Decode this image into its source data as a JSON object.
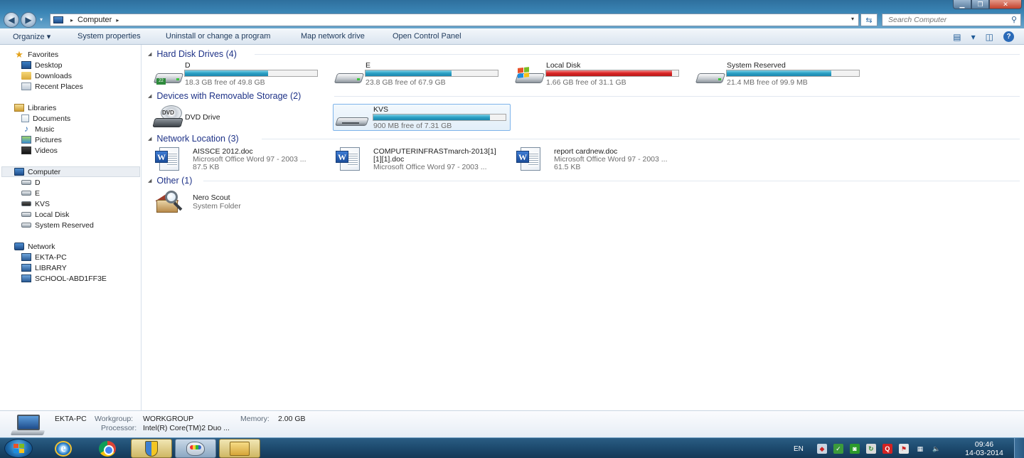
{
  "window": {
    "address": {
      "root_arrow": "▸",
      "location": "Computer",
      "trail_arrow": "▸"
    },
    "search_placeholder": "Search Computer"
  },
  "toolbar": {
    "organize": "Organize ▾",
    "system_properties": "System properties",
    "uninstall": "Uninstall or change a program",
    "map_drive": "Map network drive",
    "control_panel": "Open Control Panel",
    "views_dd": "▾",
    "help": "?"
  },
  "sidebar": {
    "favorites": {
      "label": "Favorites",
      "items": [
        {
          "label": "Desktop"
        },
        {
          "label": "Downloads"
        },
        {
          "label": "Recent Places"
        }
      ]
    },
    "libraries": {
      "label": "Libraries",
      "items": [
        {
          "label": "Documents"
        },
        {
          "label": "Music"
        },
        {
          "label": "Pictures"
        },
        {
          "label": "Videos"
        }
      ]
    },
    "computer": {
      "label": "Computer",
      "items": [
        {
          "label": "D"
        },
        {
          "label": "E"
        },
        {
          "label": "KVS"
        },
        {
          "label": "Local Disk"
        },
        {
          "label": "System Reserved"
        }
      ]
    },
    "network": {
      "label": "Network",
      "items": [
        {
          "label": "EKTA-PC"
        },
        {
          "label": "LIBRARY"
        },
        {
          "label": "SCHOOL-ABD1FF3E"
        }
      ]
    }
  },
  "groups": {
    "hard_disks": {
      "title": "Hard Disk Drives (4)",
      "items": [
        {
          "name": "D",
          "free": "18.3 GB free of 49.8 GB",
          "used_fraction": 0.63,
          "badge": "22"
        },
        {
          "name": "E",
          "free": "23.8 GB free of 67.9 GB",
          "used_fraction": 0.65
        },
        {
          "name": "Local Disk",
          "free": "1.66 GB free of 31.1 GB",
          "used_fraction": 0.95
        },
        {
          "name": "System Reserved",
          "free": "21.4 MB free of 99.9 MB",
          "used_fraction": 0.79
        }
      ]
    },
    "removable": {
      "title": "Devices with Removable Storage (2)",
      "items": [
        {
          "name": "DVD Drive",
          "icon_text": "DVD"
        },
        {
          "name": "KVS",
          "free": "900 MB free of 7.31 GB",
          "used_fraction": 0.88
        }
      ]
    },
    "network": {
      "title": "Network Location (3)",
      "items": [
        {
          "name": "AISSCE 2012.doc",
          "type": "Microsoft Office Word 97 - 2003 ...",
          "size": "87.5 KB",
          "icon_letter": "W"
        },
        {
          "name": "COMPUTERINFRASTmarch-2013[1]",
          "name2": "[1][1].doc",
          "type": "Microsoft Office Word 97 - 2003 ...",
          "icon_letter": "W"
        },
        {
          "name": "report cardnew.doc",
          "type": "Microsoft Office Word 97 - 2003 ...",
          "size": "61.5 KB",
          "icon_letter": "W"
        }
      ]
    },
    "other": {
      "title": "Other (1)",
      "items": [
        {
          "name": "Nero Scout",
          "type": "System Folder"
        }
      ]
    }
  },
  "details": {
    "name": "EKTA-PC",
    "workgroup_label": "Workgroup:",
    "workgroup": "WORKGROUP",
    "memory_label": "Memory:",
    "memory": "2.00 GB",
    "processor_label": "Processor:",
    "processor": "Intel(R) Core(TM)2 Duo ..."
  },
  "taskbar": {
    "ie_letter": "e",
    "language": "EN",
    "tray_q": "Q",
    "time": "09:46",
    "date": "14-03-2014"
  },
  "colors": {
    "drive_bar": "#2aa0c4",
    "drive_bar_full": "#d92323",
    "group_header": "#1e3287"
  }
}
